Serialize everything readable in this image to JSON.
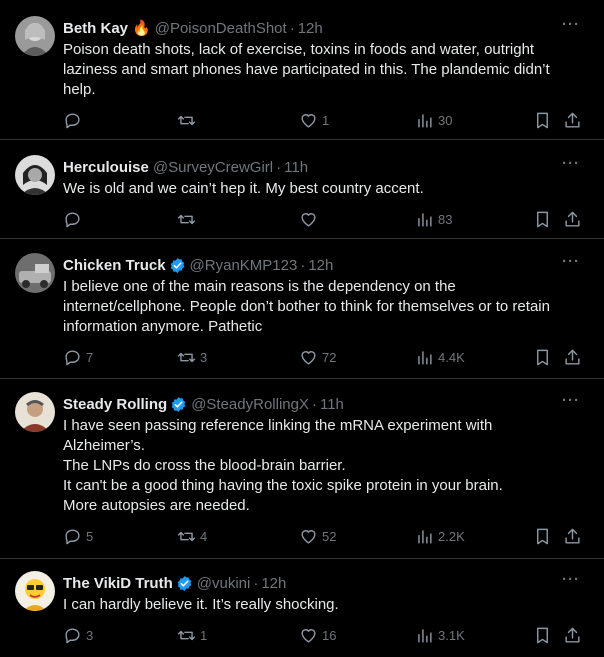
{
  "tweets": [
    {
      "name": "Beth Kay",
      "emoji": "🔥",
      "verified": false,
      "handle": "@PoisonDeathShot",
      "time": "12h",
      "lines": [
        "Poison death shots, lack of exercise, toxins in foods and water, outright",
        "laziness and smart phones have participated in this. The plandemic didn’t",
        "help."
      ],
      "replies": "",
      "retweets": "",
      "likes": "1",
      "views": "30",
      "avatar_color": "#8a8a8a"
    },
    {
      "name": "Herculouise",
      "emoji": "",
      "verified": false,
      "handle": "@SurveyCrewGirl",
      "time": "11h",
      "lines": [
        "We is old and we cain’t hep it. My best country accent."
      ],
      "replies": "",
      "retweets": "",
      "likes": "",
      "views": "83",
      "avatar_color": "#b5b5b5"
    },
    {
      "name": "Chicken Truck",
      "emoji": "",
      "verified": true,
      "handle": "@RyanKMP123",
      "time": "12h",
      "lines": [
        "I believe one of the main reasons is the dependency on the",
        "internet/cellphone. People don’t bother to think for themselves or to retain",
        "information anymore. Pathetic"
      ],
      "replies": "7",
      "retweets": "3",
      "likes": "72",
      "views": "4.4K",
      "avatar_color": "#7a7a7a"
    },
    {
      "name": "Steady Rolling",
      "emoji": "",
      "verified": true,
      "handle": "@SteadyRollingX",
      "time": "11h",
      "lines": [
        "I have seen passing reference linking the mRNA experiment with",
        "Alzheimer’s.",
        "The LNPs do cross the blood-brain barrier.",
        "It can't be a good thing having the toxic spike protein in your brain.",
        "More autopsies are needed."
      ],
      "replies": "5",
      "retweets": "4",
      "likes": "52",
      "views": "2.2K",
      "avatar_color": "#c9b39a"
    },
    {
      "name": "The VikiD Truth",
      "emoji": "",
      "verified": true,
      "handle": "@vukini",
      "time": "12h",
      "lines": [
        "I can hardly believe it. It’s really shocking."
      ],
      "replies": "3",
      "retweets": "1",
      "likes": "16",
      "views": "3.1K",
      "avatar_color": "#ffd21f"
    }
  ],
  "more_label": "···",
  "dot": "·",
  "colors": {
    "background": "#000000",
    "text": "#e7e9ea",
    "muted": "#71767b",
    "verified": "#1d9bf0",
    "divider": "#2f3336"
  }
}
